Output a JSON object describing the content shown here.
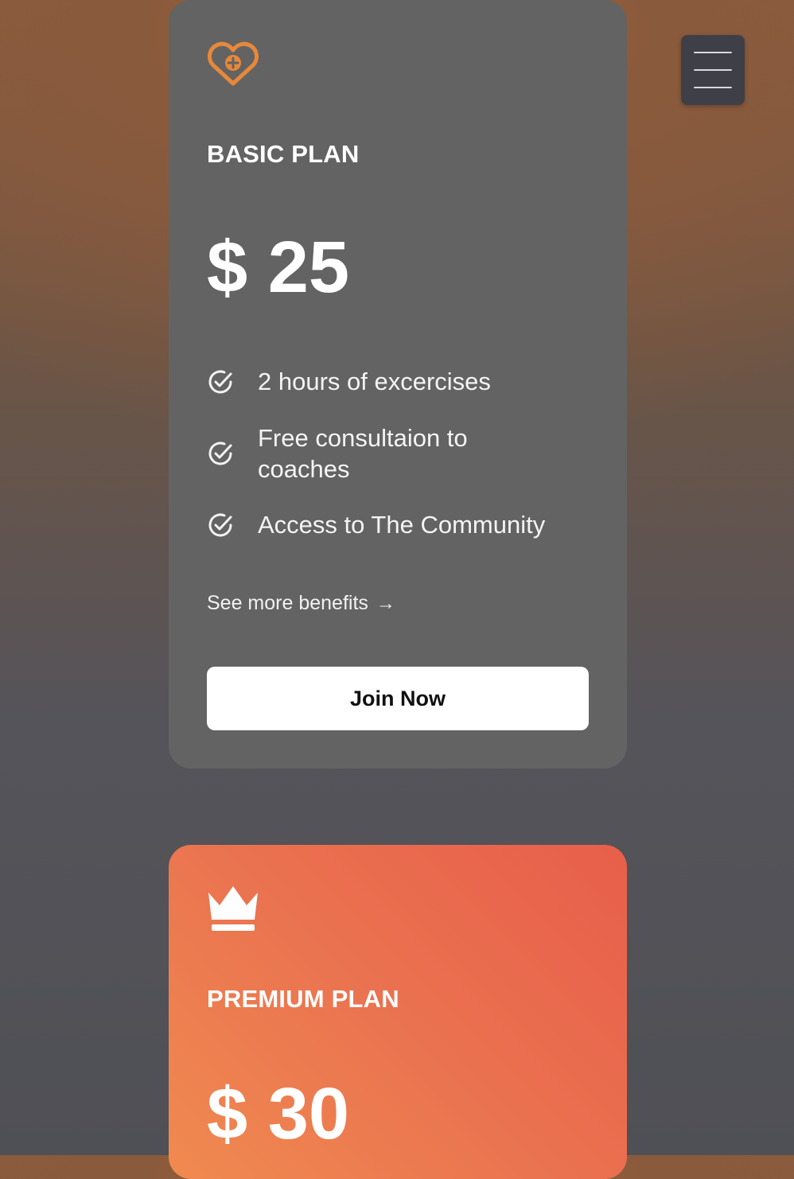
{
  "colors": {
    "basic_card_bg": "#636363",
    "accent_orange": "#e8883a",
    "premium_gradient_start": "#e85f4a",
    "premium_gradient_end": "#f08a50",
    "menu_button_bg": "#3f4047"
  },
  "menu": {
    "icon": "hamburger-menu-icon"
  },
  "basic_plan": {
    "icon": "heart-plus-icon",
    "name": "BASIC PLAN",
    "price": "$ 25",
    "features": [
      {
        "icon": "check-circle-icon",
        "text": "2 hours of excercises"
      },
      {
        "icon": "check-circle-icon",
        "text": "Free consultaion to coaches"
      },
      {
        "icon": "check-circle-icon",
        "text": "Access to The Community"
      }
    ],
    "see_more": "See more benefits",
    "see_more_arrow": "→",
    "cta": "Join Now"
  },
  "premium_plan": {
    "icon": "crown-icon",
    "name": "PREMIUM PLAN",
    "price": "$ 30"
  }
}
